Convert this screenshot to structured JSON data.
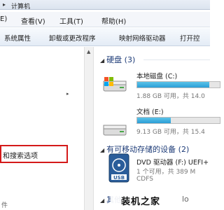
{
  "address_bar": {
    "breadcrumb": "计算机"
  },
  "menubar": {
    "items": [
      "查看(V)",
      "工具(T)",
      "帮助(H)"
    ],
    "partial_first": "E)"
  },
  "toolbar": {
    "items": [
      "系统属性",
      "卸载或更改程序",
      "映射网络驱动器",
      "打开控"
    ]
  },
  "nav": {
    "highlighted_item": "和搜索选项",
    "bottom_text": "件"
  },
  "content": {
    "hard_disks": {
      "title": "硬盘 (3)",
      "drives": [
        {
          "name": "本地磁盘 (C:)",
          "free": "1.88 GB 可用，共 14.0",
          "usage_fraction": 0.87
        },
        {
          "name": "文档 (E:)",
          "free": "9.13 GB 可用，共 15.4",
          "usage_fraction": 0.41
        }
      ]
    },
    "removable": {
      "title": "有可移动存储的设备 (2)",
      "drives": [
        {
          "name": "DVD 驱动器 (F:) UEFI+",
          "free": "1 个可用，共 389 M",
          "fs": "CDFS"
        }
      ]
    },
    "other": {
      "title": "其他 ("
    }
  },
  "watermark": {
    "text": "装机之家",
    "url": "lo"
  }
}
